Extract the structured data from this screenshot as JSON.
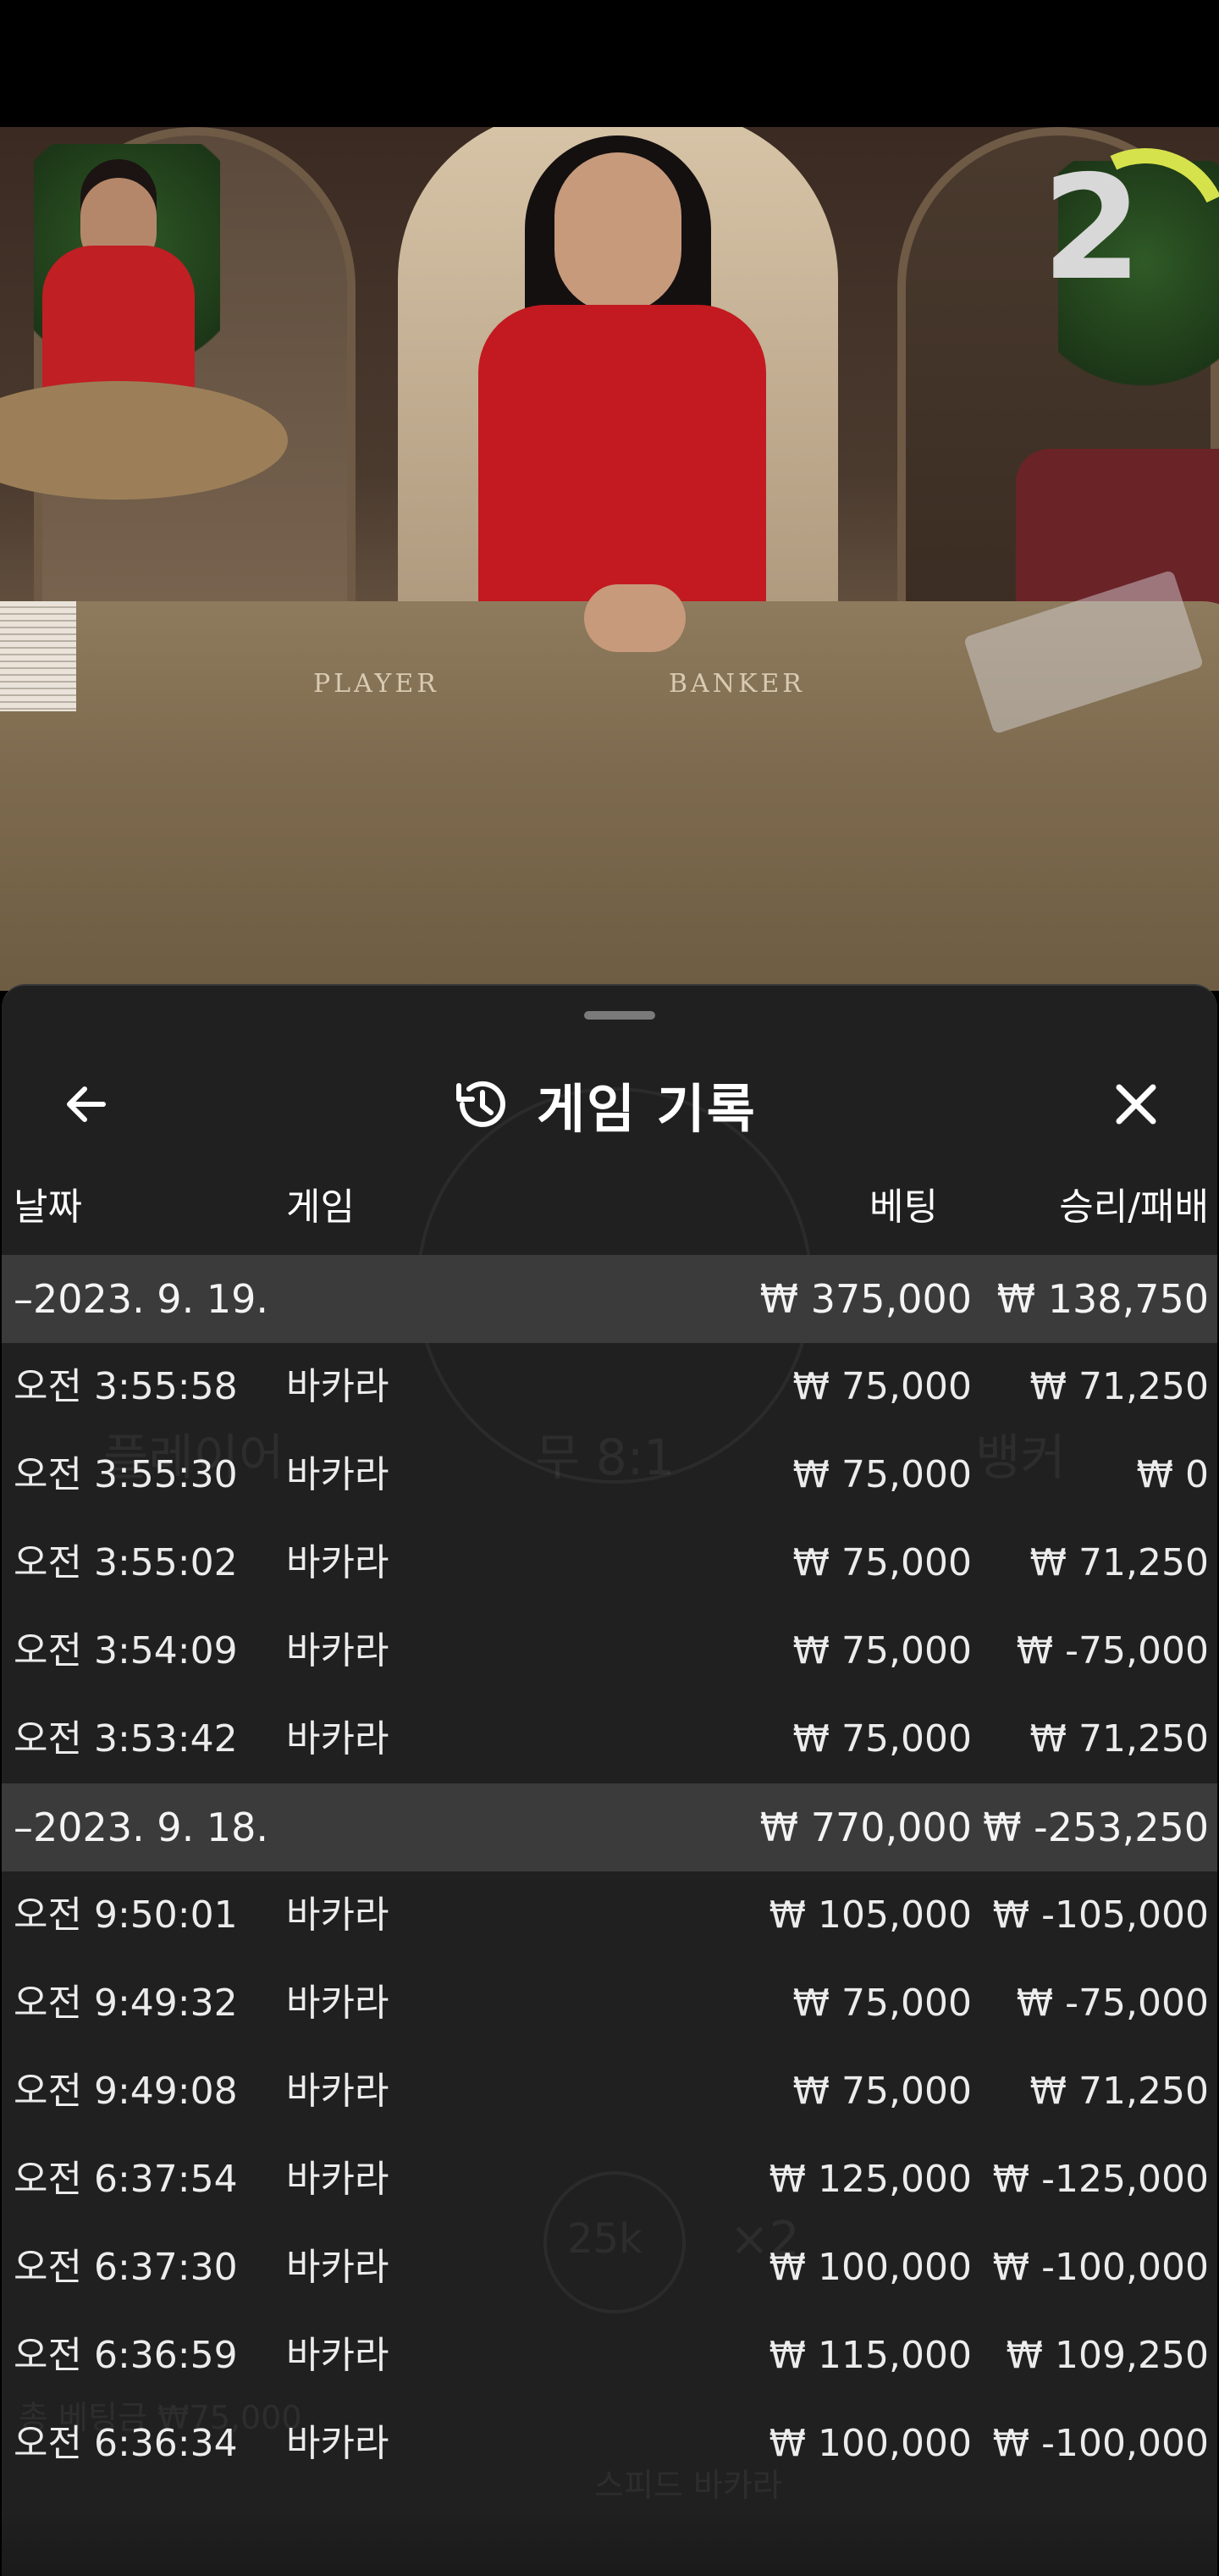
{
  "video": {
    "countdown": "2",
    "table_labels": {
      "player": "PLAYER",
      "banker": "BANKER"
    }
  },
  "sheet": {
    "title": "게임 기록",
    "icons": {
      "back": "arrow-left-icon",
      "history": "history-icon",
      "close": "close-icon"
    },
    "columns": {
      "date": "날짜",
      "game": "게임",
      "bet": "베팅",
      "result": "승리/패배"
    },
    "rows": [
      {
        "type": "group",
        "date": "–2023. 9. 19.",
        "game": "",
        "bet": "₩ 375,000",
        "result": "₩ 138,750"
      },
      {
        "type": "item",
        "date": "오전 3:55:58",
        "game": "바카라",
        "bet": "₩ 75,000",
        "result": "₩ 71,250"
      },
      {
        "type": "item",
        "date": "오전 3:55:30",
        "game": "바카라",
        "bet": "₩ 75,000",
        "result": "₩ 0"
      },
      {
        "type": "item",
        "date": "오전 3:55:02",
        "game": "바카라",
        "bet": "₩ 75,000",
        "result": "₩ 71,250"
      },
      {
        "type": "item",
        "date": "오전 3:54:09",
        "game": "바카라",
        "bet": "₩ 75,000",
        "result": "₩ -75,000"
      },
      {
        "type": "item",
        "date": "오전 3:53:42",
        "game": "바카라",
        "bet": "₩ 75,000",
        "result": "₩ 71,250"
      },
      {
        "type": "group",
        "date": "–2023. 9. 18.",
        "game": "",
        "bet": "₩ 770,000",
        "result": "₩ -253,250"
      },
      {
        "type": "item",
        "date": "오전 9:50:01",
        "game": "바카라",
        "bet": "₩ 105,000",
        "result": "₩ -105,000"
      },
      {
        "type": "item",
        "date": "오전 9:49:32",
        "game": "바카라",
        "bet": "₩ 75,000",
        "result": "₩ -75,000"
      },
      {
        "type": "item",
        "date": "오전 9:49:08",
        "game": "바카라",
        "bet": "₩ 75,000",
        "result": "₩ 71,250"
      },
      {
        "type": "item",
        "date": "오전 6:37:54",
        "game": "바카라",
        "bet": "₩ 125,000",
        "result": "₩ -125,000"
      },
      {
        "type": "item",
        "date": "오전 6:37:30",
        "game": "바카라",
        "bet": "₩ 100,000",
        "result": "₩ -100,000"
      },
      {
        "type": "item",
        "date": "오전 6:36:59",
        "game": "바카라",
        "bet": "₩ 115,000",
        "result": "₩ 109,250"
      },
      {
        "type": "item",
        "date": "오전 6:36:34",
        "game": "바카라",
        "bet": "₩ 100,000",
        "result": "₩ -100,000"
      }
    ]
  },
  "background_ui": {
    "player": "플레이어",
    "tie": "무 8:1",
    "banker": "뱅커",
    "chip": "25k",
    "multiplier": "×2",
    "total_bet": "총 베팅금 ₩75,000",
    "game_name": "스피드 바카라"
  }
}
